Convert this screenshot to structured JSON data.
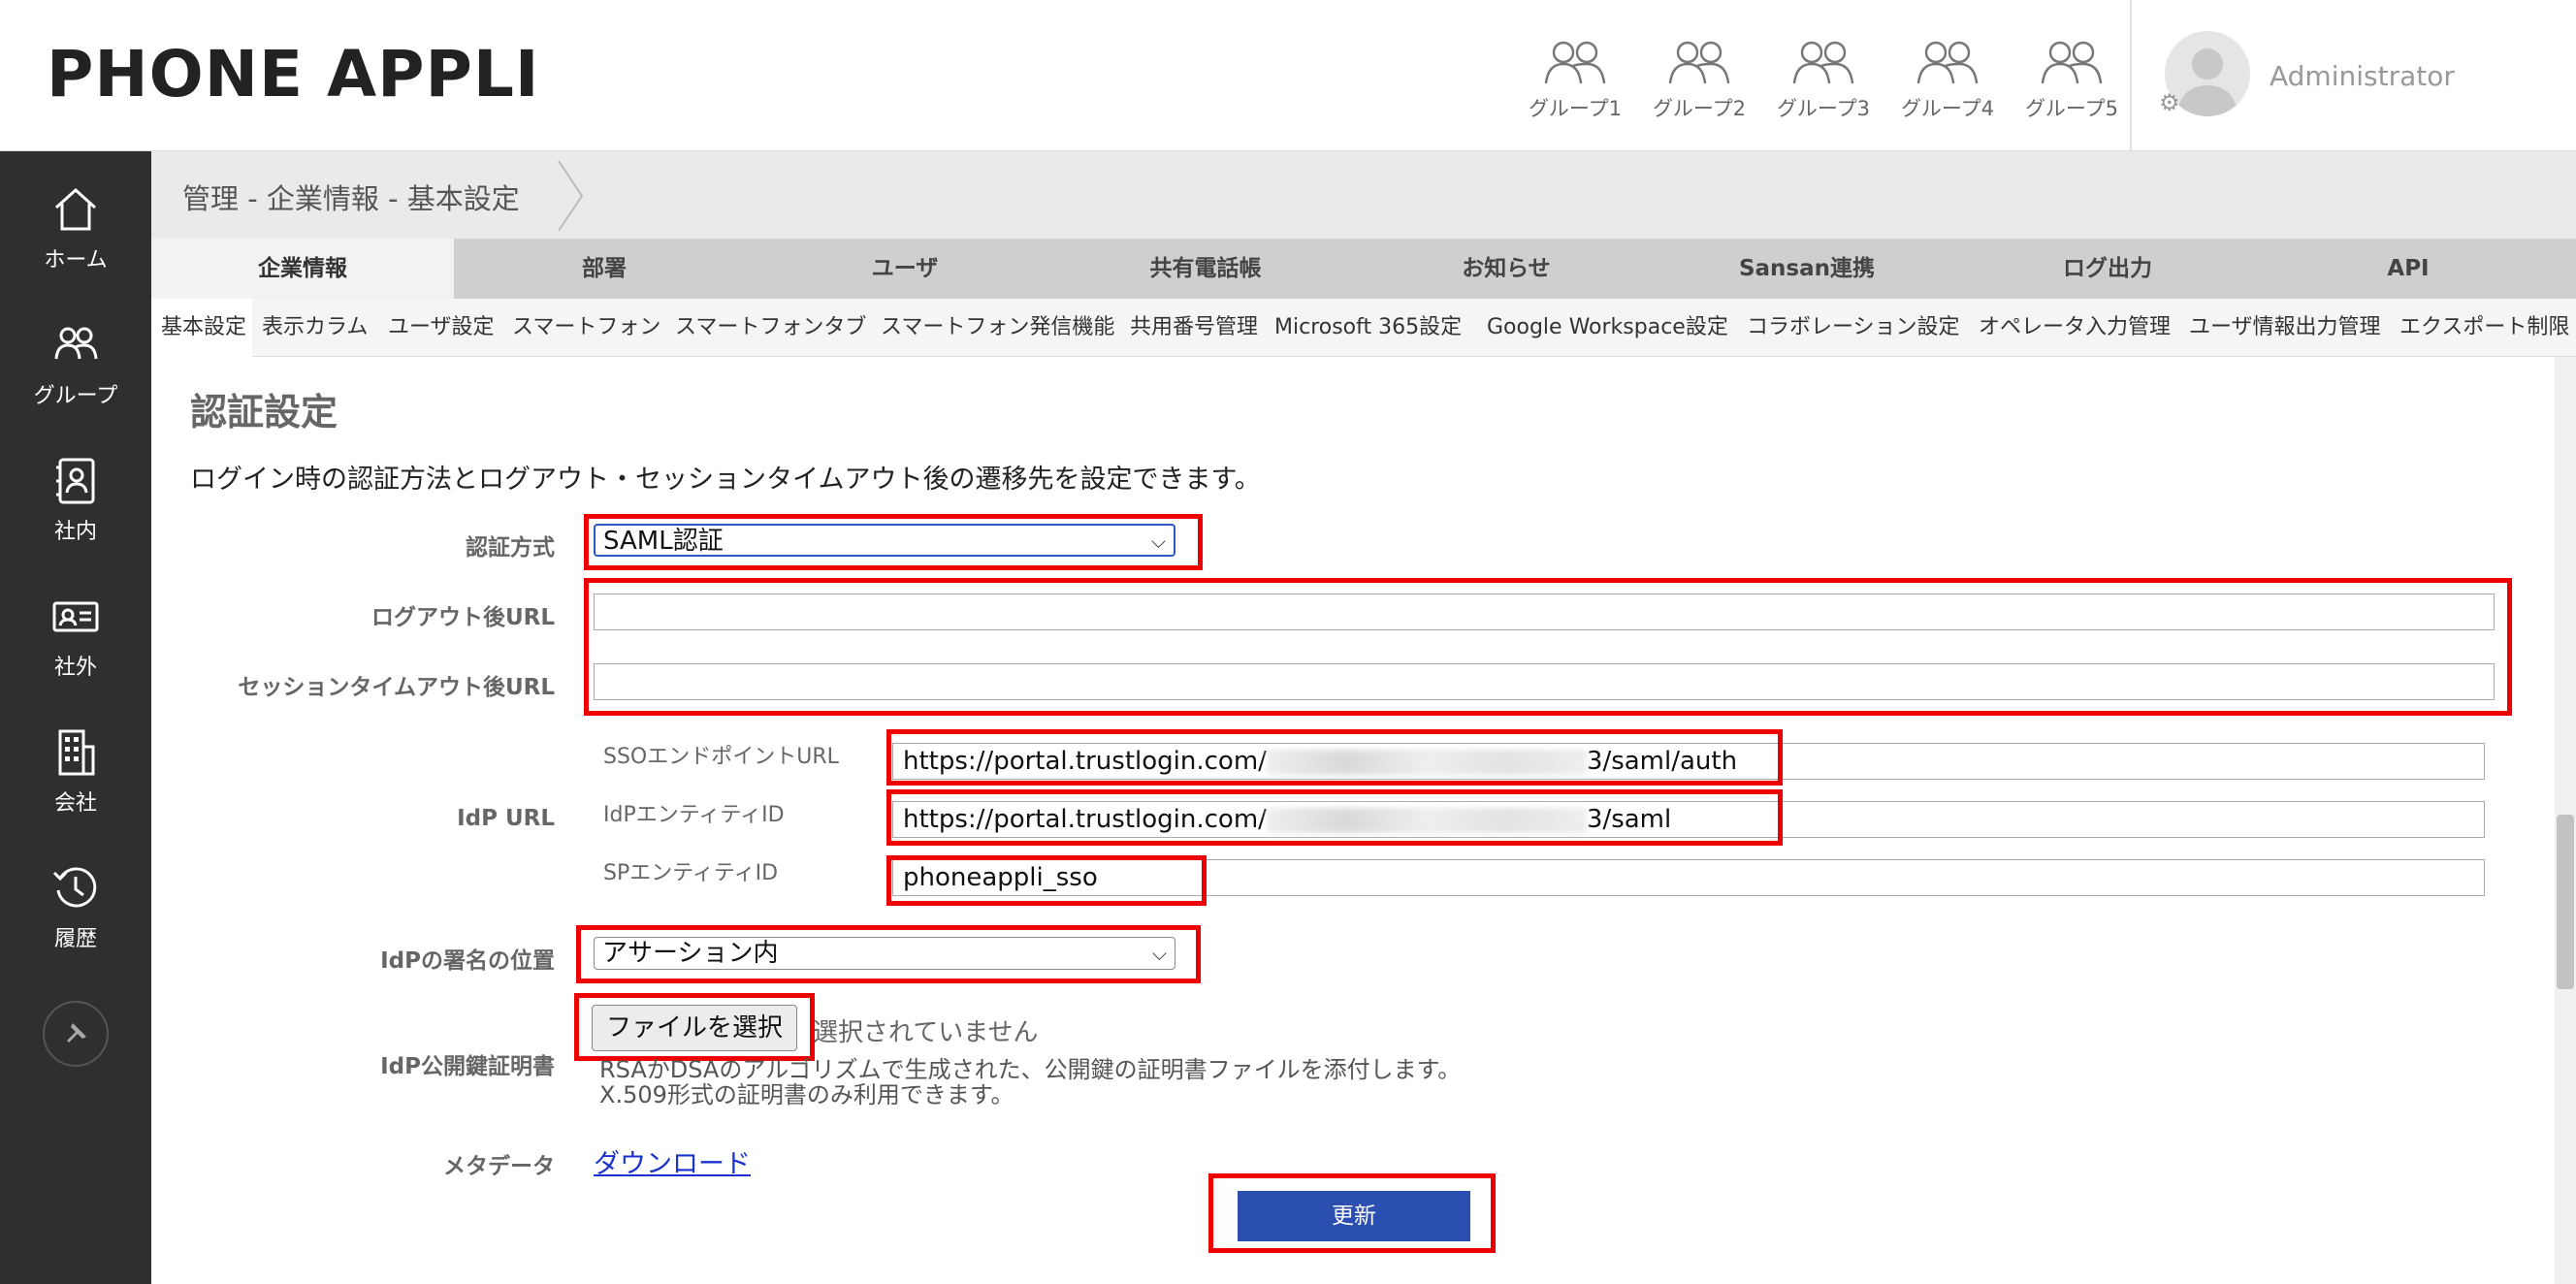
{
  "header": {
    "logo": "PHONE APPLI",
    "groups": [
      "グループ1",
      "グループ2",
      "グループ3",
      "グループ4",
      "グループ5"
    ],
    "user": "Administrator"
  },
  "sidebar": {
    "items": [
      {
        "label": "ホーム",
        "icon": "home-icon"
      },
      {
        "label": "グループ",
        "icon": "group-icon"
      },
      {
        "label": "社内",
        "icon": "internal-contacts-icon"
      },
      {
        "label": "社外",
        "icon": "external-contacts-icon"
      },
      {
        "label": "会社",
        "icon": "company-building-icon"
      },
      {
        "label": "履歴",
        "icon": "history-icon"
      }
    ],
    "pin_icon": "pin-icon"
  },
  "breadcrumb": "管理 - 企業情報 - 基本設定",
  "tabs": [
    "企業情報",
    "部署",
    "ユーザ",
    "共有電話帳",
    "お知らせ",
    "Sansan連携",
    "ログ出力",
    "API"
  ],
  "subtabs": [
    "基本設定",
    "表示カラム",
    "ユーザ設定",
    "スマートフォン",
    "スマートフォンタブ",
    "スマートフォン発信機能",
    "共用番号管理",
    "Microsoft 365設定",
    "Google Workspace設定",
    "コラボレーション設定",
    "オペレータ入力管理",
    "ユーザ情報出力管理",
    "エクスポート制限"
  ],
  "section": {
    "title": "認証設定",
    "description": "ログイン時の認証方法とログアウト・セッションタイムアウト後の遷移先を設定できます。"
  },
  "form": {
    "auth_method": {
      "label": "認証方式",
      "value": "SAML認証"
    },
    "logout_url": {
      "label": "ログアウト後URL",
      "value": ""
    },
    "session_timeout_url": {
      "label": "セッションタイムアウト後URL",
      "value": ""
    },
    "idp_url": {
      "label": "IdP URL",
      "sso_endpoint": {
        "label": "SSOエンドポイントURL",
        "prefix": "https://portal.trustlogin.com/",
        "suffix": "3/saml/auth"
      },
      "idp_entity": {
        "label": "IdPエンティティID",
        "prefix": "https://portal.trustlogin.com/",
        "suffix": "3/saml"
      },
      "sp_entity": {
        "label": "SPエンティティID",
        "value": "phoneappli_sso"
      }
    },
    "signature_position": {
      "label": "IdPの署名の位置",
      "value": "アサーション内"
    },
    "certificate": {
      "label": "IdP公開鍵証明書",
      "button": "ファイルを選択",
      "status": "選択されていません",
      "help_line1": "RSAかDSAのアルゴリズムで生成された、公開鍵の証明書ファイルを添付します。",
      "help_line2": "X.509形式の証明書のみ利用できます。"
    },
    "metadata": {
      "label": "メタデータ",
      "link": "ダウンロード"
    },
    "submit": "更新"
  },
  "colors": {
    "sidebar": "#2f2f2f",
    "highlight": "#ee0000",
    "primary": "#2a4fb0",
    "link": "#1a33cc"
  }
}
